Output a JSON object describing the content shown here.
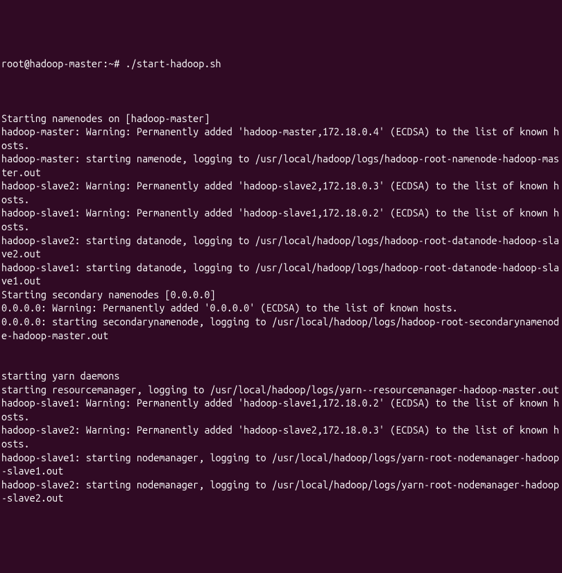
{
  "terminal": {
    "prompt": "root@hadoop-master:~# ",
    "command": "./start-hadoop.sh",
    "lines": [
      "",
      "",
      "Starting namenodes on [hadoop-master]",
      "hadoop-master: Warning: Permanently added 'hadoop-master,172.18.0.4' (ECDSA) to the list of known hosts.",
      "hadoop-master: starting namenode, logging to /usr/local/hadoop/logs/hadoop-root-namenode-hadoop-master.out",
      "hadoop-slave2: Warning: Permanently added 'hadoop-slave2,172.18.0.3' (ECDSA) to the list of known hosts.",
      "hadoop-slave1: Warning: Permanently added 'hadoop-slave1,172.18.0.2' (ECDSA) to the list of known hosts.",
      "hadoop-slave2: starting datanode, logging to /usr/local/hadoop/logs/hadoop-root-datanode-hadoop-slave2.out",
      "hadoop-slave1: starting datanode, logging to /usr/local/hadoop/logs/hadoop-root-datanode-hadoop-slave1.out",
      "Starting secondary namenodes [0.0.0.0]",
      "0.0.0.0: Warning: Permanently added '0.0.0.0' (ECDSA) to the list of known hosts.",
      "0.0.0.0: starting secondarynamenode, logging to /usr/local/hadoop/logs/hadoop-root-secondarynamenode-hadoop-master.out",
      "",
      "",
      "starting yarn daemons",
      "starting resourcemanager, logging to /usr/local/hadoop/logs/yarn--resourcemanager-hadoop-master.out",
      "hadoop-slave1: Warning: Permanently added 'hadoop-slave1,172.18.0.2' (ECDSA) to the list of known hosts.",
      "hadoop-slave2: Warning: Permanently added 'hadoop-slave2,172.18.0.3' (ECDSA) to the list of known hosts.",
      "hadoop-slave1: starting nodemanager, logging to /usr/local/hadoop/logs/yarn-root-nodemanager-hadoop-slave1.out",
      "hadoop-slave2: starting nodemanager, logging to /usr/local/hadoop/logs/yarn-root-nodemanager-hadoop-slave2.out"
    ]
  }
}
